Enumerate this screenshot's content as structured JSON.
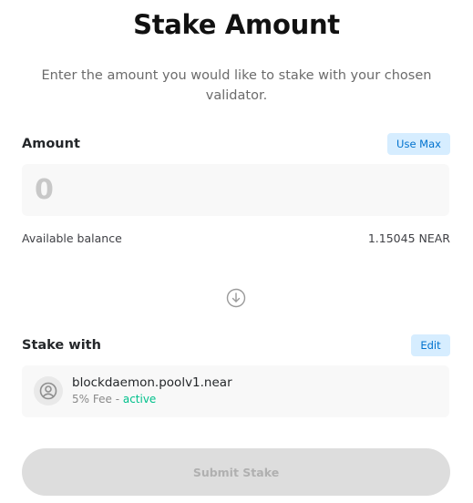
{
  "header": {
    "title": "Stake Amount",
    "subtitle": "Enter the amount you would like to stake with your chosen validator."
  },
  "amount": {
    "label": "Amount",
    "use_max_label": "Use Max",
    "input_value": "",
    "input_placeholder": "0",
    "balance_label": "Available balance",
    "balance_value": "1.15045 NEAR"
  },
  "arrow_icon": "arrow-down-circle",
  "stake_with": {
    "label": "Stake with",
    "edit_label": "Edit",
    "validator": {
      "name": "blockdaemon.poolv1.near",
      "fee": "5% Fee",
      "separator": " - ",
      "status": "active",
      "avatar_icon": "validator-avatar"
    }
  },
  "submit": {
    "label": "Submit Stake",
    "disabled": true
  },
  "colors": {
    "accent": "#0072ce",
    "accent_bg": "#d6edff",
    "active_status": "#00c08b",
    "disabled_bg": "#dddddd",
    "disabled_text": "#b0b0b0"
  }
}
